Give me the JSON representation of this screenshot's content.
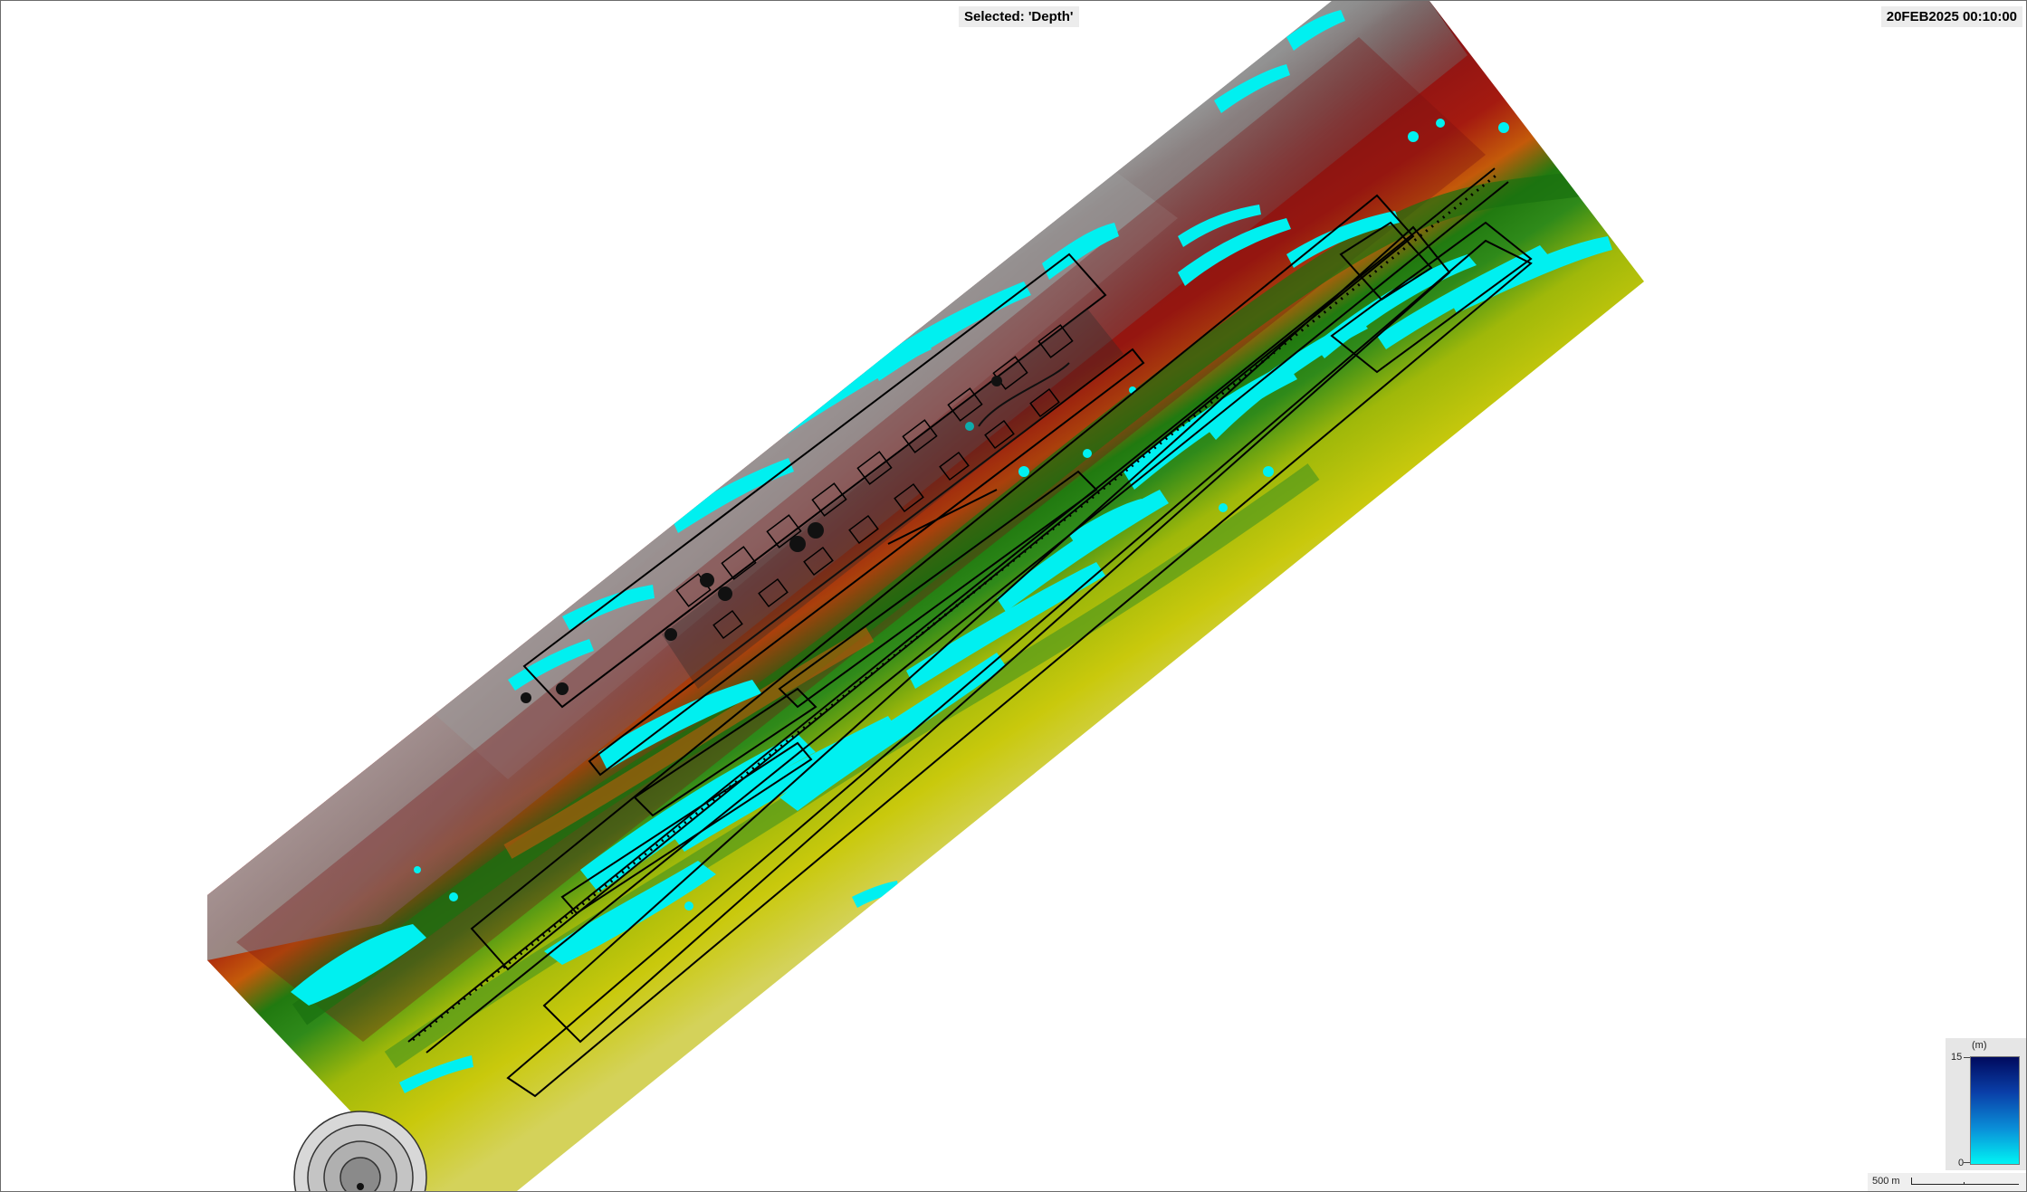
{
  "map": {
    "selected_layer": "Selected: 'Depth'",
    "timestamp": "20FEB2025 00:10:00",
    "colors": {
      "water": "#00f0f0",
      "terrain_high": "#5a0f0f",
      "terrain_mid": "#a01212",
      "terrain_orange": "#cc6a00",
      "terrain_green": "#1f7a10",
      "terrain_yellow": "#c8c800",
      "hillshade": "#8a8a8a",
      "outline": "#000000"
    },
    "legend": {
      "unit": "(m)",
      "max": "15",
      "min": "0",
      "ramp_colors": [
        "#000a5e",
        "#0a3fa8",
        "#0a8fd8",
        "#00f4f4"
      ]
    },
    "scale_bar": {
      "label": "500 m"
    },
    "icons": {
      "compass": "compass-rose-icon"
    }
  }
}
